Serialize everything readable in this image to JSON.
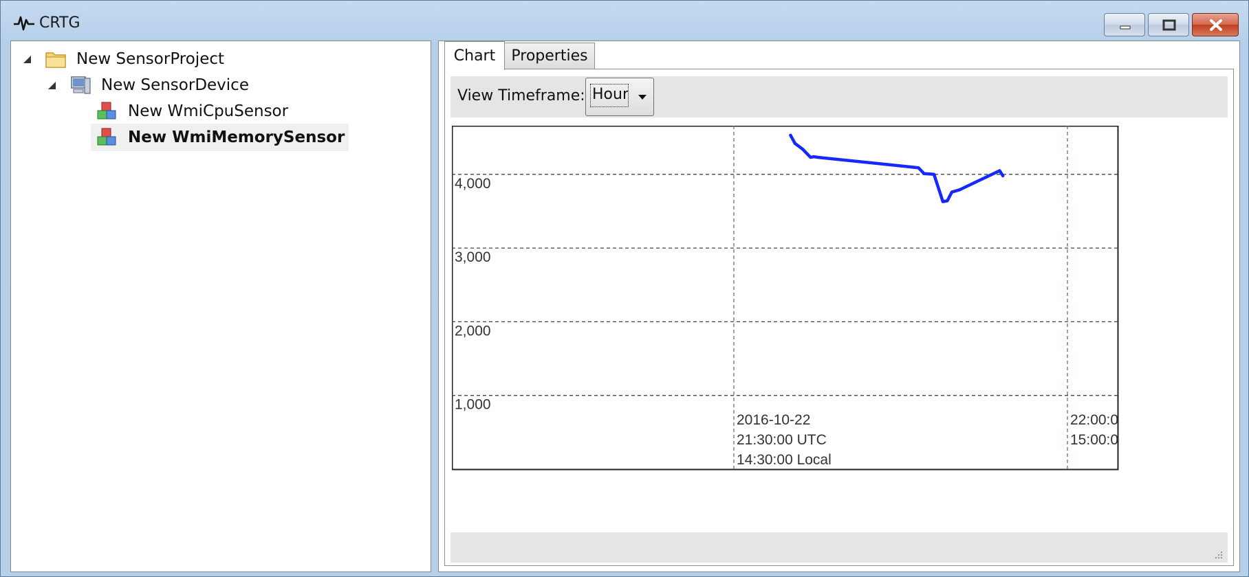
{
  "window": {
    "title": "CRTG"
  },
  "tree": {
    "items": [
      {
        "label": "New SensorProject",
        "icon": "folder-icon",
        "level": 0,
        "expanded": true
      },
      {
        "label": "New SensorDevice",
        "icon": "computer-icon",
        "level": 1,
        "expanded": true
      },
      {
        "label": "New WmiCpuSensor",
        "icon": "sensor-cubes-icon",
        "level": 2
      },
      {
        "label": "New WmiMemorySensor",
        "icon": "sensor-cubes-icon",
        "level": 2,
        "selected": true
      }
    ]
  },
  "tabs": [
    {
      "label": "Chart",
      "active": true
    },
    {
      "label": "Properties",
      "active": false
    }
  ],
  "toolbar": {
    "timeframe_label": "View Timeframe:",
    "timeframe_value": "Hour"
  },
  "chart_data": {
    "type": "line",
    "title": "",
    "xlabel": "",
    "ylabel": "",
    "ylim": [
      0,
      4660
    ],
    "yticks": [
      {
        "value": 1000,
        "label": "1,000"
      },
      {
        "value": 2000,
        "label": "2,000"
      },
      {
        "value": 3000,
        "label": "3,000"
      },
      {
        "value": 4000,
        "label": "4,000"
      }
    ],
    "grid": true,
    "line_color": "#1428ff",
    "x_axis_labels": [
      {
        "lines": [
          "2016-10-22",
          "21:30:00 UTC",
          "14:30:00 Local"
        ]
      },
      {
        "lines": [
          "22:00:0",
          "15:00:0"
        ]
      }
    ],
    "series": [
      {
        "x_minutes_after_2130": [
          5.1,
          5.5,
          6.2,
          6.9,
          7.2,
          7.6,
          16.6,
          17.1,
          18.0,
          18.8,
          19.2,
          19.6,
          20.3,
          23.9,
          24.2
        ],
        "values": [
          4530,
          4420,
          4340,
          4230,
          4240,
          4230,
          4090,
          4010,
          4000,
          3630,
          3640,
          3760,
          3790,
          4050,
          3980
        ]
      }
    ]
  }
}
